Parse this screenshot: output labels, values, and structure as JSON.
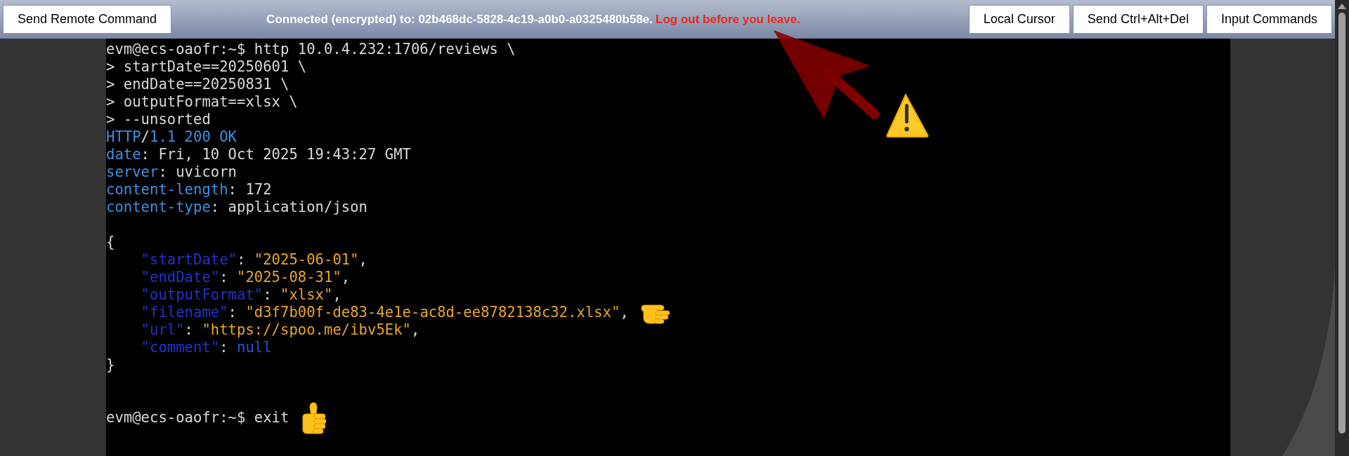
{
  "toolbar": {
    "left_buttons": [
      "Send Remote Command"
    ],
    "status": {
      "text": "Connected (encrypted) to: 02b468dc-5828-4c19-a0b0-a0325480b58e.",
      "warning": "Log out before you leave."
    },
    "right_buttons": [
      "Local Cursor",
      "Send Ctrl+Alt+Del",
      "Input Commands"
    ]
  },
  "terminal": {
    "lines": [
      {
        "kind": "text",
        "segments": [
          {
            "kind": "plain",
            "text": "evm@ecs-oaofr:~$ http 10.0.4.232:1706/reviews \\"
          }
        ]
      },
      {
        "kind": "text",
        "segments": [
          {
            "kind": "plain",
            "text": "> startDate==20250601 \\"
          }
        ]
      },
      {
        "kind": "text",
        "segments": [
          {
            "kind": "plain",
            "text": "> endDate==20250831 \\"
          }
        ]
      },
      {
        "kind": "text",
        "segments": [
          {
            "kind": "plain",
            "text": "> outputFormat==xlsx \\"
          }
        ]
      },
      {
        "kind": "text",
        "segments": [
          {
            "kind": "plain",
            "text": "> --unsorted"
          }
        ]
      },
      {
        "kind": "text",
        "segments": [
          {
            "kind": "header",
            "text": "HTTP"
          },
          {
            "kind": "plain",
            "text": "/"
          },
          {
            "kind": "header",
            "text": "1.1 200 OK"
          }
        ]
      },
      {
        "kind": "text",
        "segments": [
          {
            "kind": "header",
            "text": "date"
          },
          {
            "kind": "plain",
            "text": ": Fri, 10 Oct 2025 19:43:27 GMT"
          }
        ]
      },
      {
        "kind": "text",
        "segments": [
          {
            "kind": "header",
            "text": "server"
          },
          {
            "kind": "plain",
            "text": ": uvicorn"
          }
        ]
      },
      {
        "kind": "text",
        "segments": [
          {
            "kind": "header",
            "text": "content-length"
          },
          {
            "kind": "plain",
            "text": ": 172"
          }
        ]
      },
      {
        "kind": "text",
        "segments": [
          {
            "kind": "header",
            "text": "content-type"
          },
          {
            "kind": "plain",
            "text": ": application/json"
          }
        ]
      },
      {
        "kind": "blank"
      },
      {
        "kind": "text",
        "segments": [
          {
            "kind": "plain",
            "text": "{"
          }
        ]
      },
      {
        "kind": "text",
        "segments": [
          {
            "kind": "key",
            "text": "    \"startDate\""
          },
          {
            "kind": "plain",
            "text": ": "
          },
          {
            "kind": "string",
            "text": "\"2025-06-01\""
          },
          {
            "kind": "plain",
            "text": ","
          }
        ]
      },
      {
        "kind": "text",
        "segments": [
          {
            "kind": "key",
            "text": "    \"endDate\""
          },
          {
            "kind": "plain",
            "text": ": "
          },
          {
            "kind": "string",
            "text": "\"2025-08-31\""
          },
          {
            "kind": "plain",
            "text": ","
          }
        ]
      },
      {
        "kind": "text",
        "segments": [
          {
            "kind": "key",
            "text": "    \"outputFormat\""
          },
          {
            "kind": "plain",
            "text": ": "
          },
          {
            "kind": "string",
            "text": "\"xlsx\""
          },
          {
            "kind": "plain",
            "text": ","
          }
        ]
      },
      {
        "kind": "text",
        "segments": [
          {
            "kind": "key",
            "text": "    \"filename\""
          },
          {
            "kind": "plain",
            "text": ": "
          },
          {
            "kind": "string",
            "text": "\"d3f7b00f-de83-4e1e-ac8d-ee8782138c32.xlsx\""
          },
          {
            "kind": "plain",
            "text": ","
          }
        ]
      },
      {
        "kind": "text",
        "segments": [
          {
            "kind": "key",
            "text": "    \"url\""
          },
          {
            "kind": "plain",
            "text": ": "
          },
          {
            "kind": "string",
            "text": "\"https://spoo.me/ibv5Ek\""
          },
          {
            "kind": "plain",
            "text": ","
          }
        ]
      },
      {
        "kind": "text",
        "segments": [
          {
            "kind": "key",
            "text": "    \"comment\""
          },
          {
            "kind": "plain",
            "text": ": "
          },
          {
            "kind": "literal",
            "text": "null"
          }
        ]
      },
      {
        "kind": "text",
        "segments": [
          {
            "kind": "plain",
            "text": "}"
          }
        ]
      },
      {
        "kind": "blank"
      },
      {
        "kind": "blank"
      },
      {
        "kind": "text",
        "segments": [
          {
            "kind": "plain",
            "text": "evm@ecs-oaofr:~$ exit"
          }
        ]
      }
    ]
  }
}
